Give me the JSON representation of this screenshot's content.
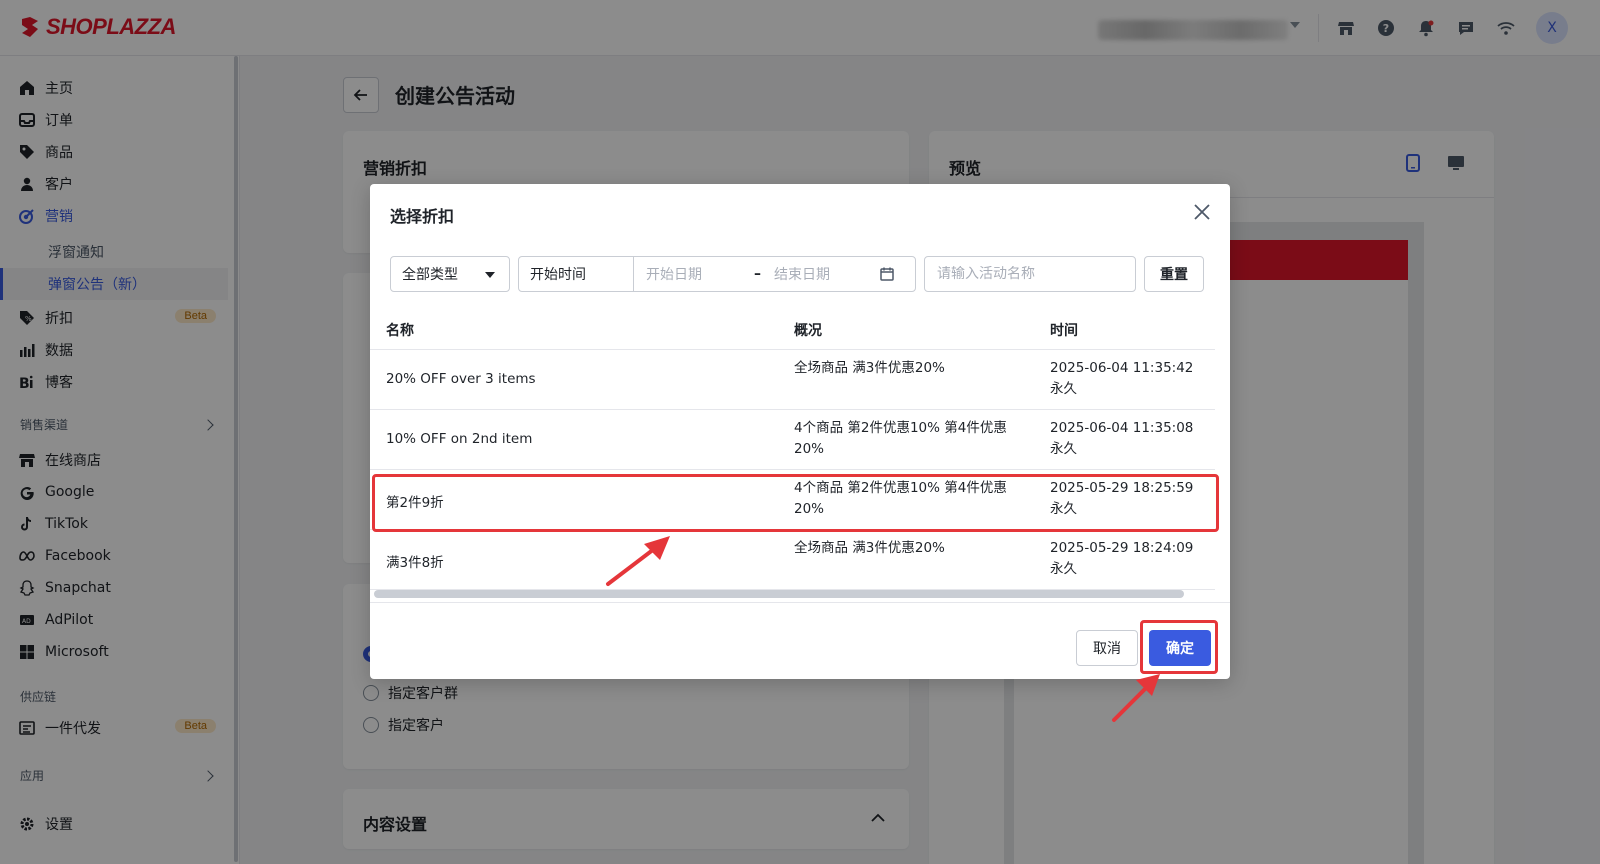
{
  "app": {
    "logo_text": "SHOPLAZZA",
    "avatar_initial": "X"
  },
  "sidebar": {
    "items": [
      {
        "label": "主页",
        "icon": "home-icon"
      },
      {
        "label": "订单",
        "icon": "inbox-icon"
      },
      {
        "label": "商品",
        "icon": "tag-icon"
      },
      {
        "label": "客户",
        "icon": "user-icon"
      },
      {
        "label": "营销",
        "icon": "target-icon"
      }
    ],
    "marketing_sub": [
      {
        "label": "浮窗通知"
      },
      {
        "label": "弹窗公告（新）"
      }
    ],
    "items2": [
      {
        "label": "折扣",
        "icon": "discount-icon",
        "badge": "Beta"
      },
      {
        "label": "数据",
        "icon": "bar-chart-icon"
      },
      {
        "label": "博客",
        "icon": "blog-icon"
      }
    ],
    "sales_section": "销售渠道",
    "channels": [
      {
        "label": "在线商店"
      },
      {
        "label": "Google"
      },
      {
        "label": "TikTok"
      },
      {
        "label": "Facebook"
      },
      {
        "label": "Snapchat"
      },
      {
        "label": "AdPilot"
      },
      {
        "label": "Microsoft"
      }
    ],
    "supply_section": "供应链",
    "supply_items": [
      {
        "label": "一件代发",
        "badge": "Beta"
      }
    ],
    "apps_section": "应用",
    "settings_label": "设置"
  },
  "page": {
    "title": "创建公告活动",
    "marketing_card_title": "营销折扣",
    "preview_title": "预览",
    "content_card_title": "内容设置",
    "radio_options": [
      "指定客户群",
      "指定客户"
    ]
  },
  "modal": {
    "title": "选择折扣",
    "filters": {
      "type_select": "全部类型",
      "time_label": "开始时间",
      "start_placeholder": "开始日期",
      "end_placeholder": "结束日期",
      "search_placeholder": "请输入活动名称",
      "reset_label": "重置"
    },
    "columns": [
      "名称",
      "概况",
      "时间"
    ],
    "rows": [
      {
        "name": "20% OFF over 3 items",
        "desc": "全场商品 满3件优惠20%",
        "time": "2025-06-04 11:35:42",
        "duration": "永久"
      },
      {
        "name": "10% OFF on 2nd item",
        "desc": "4个商品 第2件优惠10% 第4件优惠20%",
        "time": "2025-06-04 11:35:08",
        "duration": "永久"
      },
      {
        "name": "第2件9折",
        "desc": "4个商品 第2件优惠10% 第4件优惠20%",
        "time": "2025-05-29 18:25:59",
        "duration": "永久"
      },
      {
        "name": "满3件8折",
        "desc": "全场商品 满3件优惠20%",
        "time": "2025-05-29 18:24:09",
        "duration": "永久"
      }
    ],
    "cancel_label": "取消",
    "confirm_label": "确定"
  },
  "colors": {
    "accent": "#3a5be0",
    "brand": "#e0162b",
    "highlight": "#e5363a"
  }
}
